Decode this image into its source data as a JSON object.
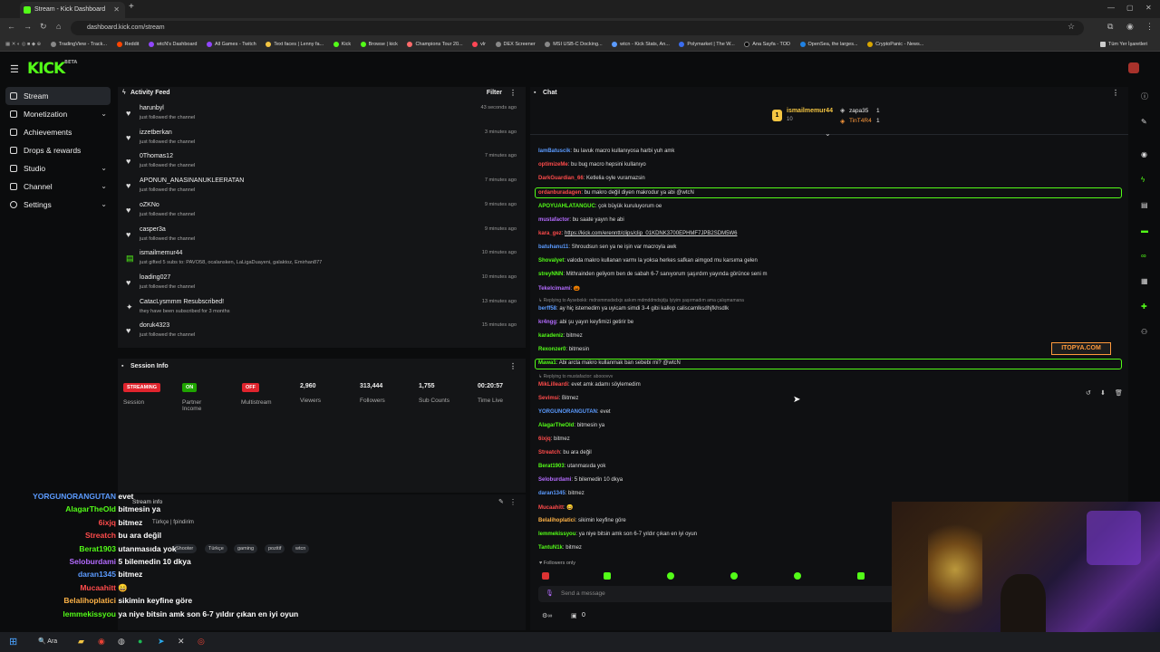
{
  "browser": {
    "tab_title": "Stream - Kick Dashboard",
    "url": "dashboard.kick.com/stream",
    "bookmarks": [
      "TradingView - Track...",
      "Reddit",
      "wtcN's Dashboard",
      "All Games - Twitch",
      "Text faces | Lenny fa...",
      "Kick",
      "Browse | kick",
      "Champions Tour 20...",
      "vlr",
      "DEX Screener",
      "MSI USB-C Docking...",
      "wtcn - Kick Stats, An...",
      "Polymarket | The W...",
      "Ana Sayfa - TOD",
      "OpenSea, the larges...",
      "CryptoPanic - News...",
      "Tüm Yer İşaretleri"
    ]
  },
  "app": {
    "logo": "KICK",
    "logo_sup": "BETA"
  },
  "sidebar": {
    "items": [
      {
        "label": "Stream"
      },
      {
        "label": "Monetization"
      },
      {
        "label": "Achievements"
      },
      {
        "label": "Drops & rewards"
      },
      {
        "label": "Studio"
      },
      {
        "label": "Channel"
      },
      {
        "label": "Settings"
      }
    ]
  },
  "activity": {
    "title": "Activity Feed",
    "filter": "Filter",
    "rows": [
      {
        "name": "harunbyl",
        "action": "just followed the channel",
        "time": "43 seconds ago"
      },
      {
        "name": "izzetberkan",
        "action": "just followed the channel",
        "time": "3 minutes ago"
      },
      {
        "name": "0Thomas12",
        "action": "just followed the channel",
        "time": "7 minutes ago"
      },
      {
        "name": "APONUN_ANASINANUKLEERATAN",
        "action": "just followed the channel",
        "time": "7 minutes ago"
      },
      {
        "name": "oZKNo",
        "action": "just followed the channel",
        "time": "9 minutes ago"
      },
      {
        "name": "casper3a",
        "action": "just followed the channel",
        "time": "9 minutes ago"
      },
      {
        "name": "ismailmemur44",
        "action": "just gifted 5 subs to: PAVO58, ocalansken, LaLigaDuayeni, galaktoz, Emirhan877",
        "time": "10 minutes ago"
      },
      {
        "name": "loading027",
        "action": "just followed the channel",
        "time": "10 minutes ago"
      },
      {
        "name": "CatacLysmmm Resubscribed!",
        "action": "they have been subscribed for 3 months",
        "time": "13 minutes ago"
      },
      {
        "name": "doruk4323",
        "action": "just followed the channel",
        "time": "15 minutes ago"
      }
    ]
  },
  "session": {
    "title": "Session Info",
    "streaming": "STREAMING",
    "session_label": "Session",
    "on": "ON",
    "partner": "Partner Income",
    "off": "OFF",
    "multistream": "Multistream",
    "viewers": "2,960",
    "viewers_label": "Viewers",
    "followers": "313,444",
    "followers_label": "Followers",
    "subs": "1,755",
    "subs_label": "Sub Counts",
    "time": "00:20:57",
    "time_label": "Time Live"
  },
  "stream_info": {
    "title": "Stream info",
    "tags": [
      "Türkçe",
      "gaming",
      "pozitif",
      "wtcn"
    ],
    "cat": "Shooter",
    "partial": "Türkçe | fpindirim"
  },
  "overlay_chat": [
    {
      "user": "YORGUNORANGUTAN",
      "msg": "evet",
      "color": "#5b9bff"
    },
    {
      "user": "AlagarTheOld",
      "msg": "bitmesin ya",
      "color": "#53fc18"
    },
    {
      "user": "6ixjq",
      "msg": "bitmez",
      "color": "#ff4b4b"
    },
    {
      "user": "Streatch",
      "msg": "bu ara değil",
      "color": "#ff4b4b"
    },
    {
      "user": "Berat1903",
      "msg": "utanmasıda yok",
      "color": "#53fc18"
    },
    {
      "user": "Seloburdami",
      "msg": "5 bilemedin 10 dkya",
      "color": "#b46bff"
    },
    {
      "user": "daran1345",
      "msg": "bitmez",
      "color": "#5b9bff"
    },
    {
      "user": "Mucaahitt",
      "msg": "😄",
      "color": "#ff4b4b"
    },
    {
      "user": "Belalihoplatici",
      "msg": "sikimin keyfine göre",
      "color": "#ffb347"
    },
    {
      "user": "lemmekissyou",
      "msg": "ya niye bitsin amk son 6-7 yıldır çıkan en iyi oyun",
      "color": "#53fc18"
    }
  ],
  "chat": {
    "title": "Chat",
    "top_gifters": [
      {
        "name": "ismailmemur44",
        "count": "10"
      },
      {
        "name": "zapa35",
        "count": "1"
      },
      {
        "name": "TinT4R4",
        "count": "1"
      }
    ],
    "messages": [
      {
        "user": "IamBatuscik",
        "msg": "bu lavuk macro kullanıyosa harbi yuh amk",
        "color": "#5b9bff"
      },
      {
        "user": "optimizeMe",
        "msg": "bu bug macro hepsini kullanıyo",
        "color": "#ff4b4b"
      },
      {
        "user": "DarkGuardian_66",
        "msg": "Ketlelia oyle vuramazsin",
        "color": "#ff4b4b"
      },
      {
        "user": "ordanburadagen",
        "msg": "bu makro değil diyen makrodur ya abi @wtcN",
        "color": "#ff4b4b"
      },
      {
        "user": "APOYUAHLATANGUC",
        "msg": "çok büyük kuruluyorum oe",
        "color": "#53fc18"
      },
      {
        "user": "mustafactor",
        "msg": "bu saate yayın he abi",
        "color": "#b46bff"
      },
      {
        "user": "kara_gez",
        "msg": "https://kick.com/erenntt/clips/clip_01KDNK3700EPHMF7JPB2SDM5W6",
        "color": "#ff4b4b"
      },
      {
        "user": "batuhanu11",
        "msg": "Shroudsun sen ya ne işin var macroyla awk",
        "color": "#5b9bff"
      },
      {
        "user": "Shovalyet",
        "msg": "valoda makro kullanan varmı la yoksa herkes safkan aimgod mu karsıma gelen",
        "color": "#53fc18"
      },
      {
        "user": "streyNNN",
        "msg": "Mithrainden geliyom ben de sabah 6-7 sanıyorum şaşırdım yayında görünce seni m",
        "color": "#53fc18"
      },
      {
        "user": "Tekelcimami",
        "msg": "🎃",
        "color": "#b46bff"
      },
      {
        "user": "Replying to Aysebokk",
        "msg": "mdnxmmsdxdxjx askım mdmddmdxjdju lyiyim şaşırmadım ama çalışmamana",
        "color": "#888"
      },
      {
        "user": "berff58",
        "msg": "ay hiç istemedim ya uyicam simdi 3-4 gibi kalkıp caliscamlksdhjfkhsdlk",
        "color": "#5b9bff"
      },
      {
        "user": "kr4ngg",
        "msg": "abi şu yayın keyfimizi getirir be",
        "color": "#b46bff"
      },
      {
        "user": "karadeniz",
        "msg": "bitmez",
        "color": "#53fc18"
      },
      {
        "user": "Rexonzer0",
        "msg": "bitmesin",
        "color": "#53fc18"
      },
      {
        "user": "Mawa1",
        "msg": "Abi arcta makro kullanmak ban sebebi mi? @wtcN",
        "color": "#53fc18"
      },
      {
        "user": "Replying to mustafactor",
        "msg": "abooovvv",
        "color": "#888"
      },
      {
        "user": "MikLilleardi",
        "msg": "evet amk adamı söylemedim",
        "color": "#ff4b4b"
      },
      {
        "user": "Sevimsi",
        "msg": "Bitmez",
        "color": "#ff4b4b"
      },
      {
        "user": "YORGUNORANGUTAN",
        "msg": "evet",
        "color": "#5b9bff"
      },
      {
        "user": "AlagarTheOld",
        "msg": "bitmesin ya",
        "color": "#53fc18"
      },
      {
        "user": "6ixjq",
        "msg": "bitmez",
        "color": "#ff4b4b"
      },
      {
        "user": "Streatch",
        "msg": "bu ara değil",
        "color": "#ff4b4b"
      },
      {
        "user": "Berat1903",
        "msg": "utanmasıda yok",
        "color": "#53fc18"
      },
      {
        "user": "Seloburdami",
        "msg": "5 bilemedin 10 dkya",
        "color": "#b46bff"
      },
      {
        "user": "daran1345",
        "msg": "bitmez",
        "color": "#5b9bff"
      },
      {
        "user": "Mucaahitt",
        "msg": "😄",
        "color": "#ff4b4b"
      },
      {
        "user": "Belalihoplatici",
        "msg": "sikimin keyfine göre",
        "color": "#ffb347"
      },
      {
        "user": "lemmekissyou",
        "msg": "ya niye bitsin amk son 6-7 yıldır çıkan en iyi oyun",
        "color": "#53fc18"
      },
      {
        "user": "TantuN1k",
        "msg": "bitmez",
        "color": "#53fc18"
      }
    ],
    "followers_only": "Followers only",
    "input_placeholder": "Send a message",
    "points": "0"
  },
  "taskbar": {
    "search": "Ara"
  }
}
